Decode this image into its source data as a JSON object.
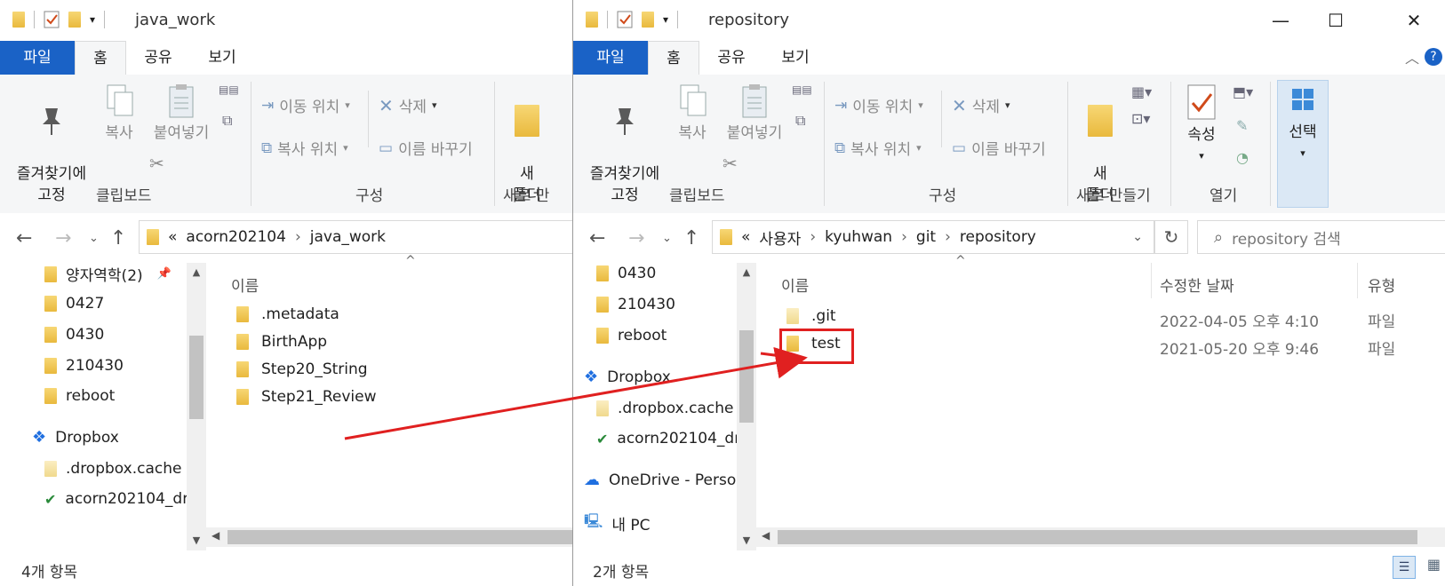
{
  "left_window": {
    "title": "java_work",
    "menu": {
      "file": "파일",
      "home": "홈",
      "share": "공유",
      "view": "보기"
    },
    "ribbon": {
      "pin": "즐겨찾기에\n고정",
      "copy": "복사",
      "paste": "붙여넣기",
      "move_to": "이동 위치",
      "copy_to": "복사 위치",
      "delete": "삭제",
      "rename": "이름 바꾸기",
      "new_folder": "새\n폴더",
      "groups": {
        "clipboard": "클립보드",
        "organize": "구성",
        "new": "새로 만"
      }
    },
    "address": {
      "overflow": "«",
      "crumbs": [
        "acorn202104",
        "java_work"
      ]
    },
    "nav": [
      {
        "label": "양자역학(2)",
        "pinned": true
      },
      {
        "label": "0427"
      },
      {
        "label": "0430"
      },
      {
        "label": "210430"
      },
      {
        "label": "reboot"
      },
      {
        "label": "Dropbox"
      },
      {
        "label": ".dropbox.cache"
      },
      {
        "label": "acorn202104_dr"
      }
    ],
    "columns": {
      "name": "이름"
    },
    "files": [
      ".metadata",
      "BirthApp",
      "Step20_String",
      "Step21_Review"
    ],
    "status": "4개 항목"
  },
  "right_window": {
    "title": "repository",
    "menu": {
      "file": "파일",
      "home": "홈",
      "share": "공유",
      "view": "보기"
    },
    "ribbon": {
      "pin": "즐겨찾기에\n고정",
      "copy": "복사",
      "paste": "붙여넣기",
      "move_to": "이동 위치",
      "copy_to": "복사 위치",
      "delete": "삭제",
      "rename": "이름 바꾸기",
      "new_folder": "새\n폴더",
      "properties": "속성",
      "select": "선택",
      "groups": {
        "clipboard": "클립보드",
        "organize": "구성",
        "new": "새로 만들기",
        "open": "열기"
      }
    },
    "address": {
      "overflow": "«",
      "crumbs": [
        "사용자",
        "kyuhwan",
        "git",
        "repository"
      ]
    },
    "search_placeholder": "repository 검색",
    "nav": [
      {
        "label": "0430"
      },
      {
        "label": "210430"
      },
      {
        "label": "reboot"
      },
      {
        "label": "Dropbox"
      },
      {
        "label": ".dropbox.cache"
      },
      {
        "label": "acorn202104_dr"
      },
      {
        "label": "OneDrive - Persor"
      },
      {
        "label": "내 PC"
      }
    ],
    "columns": {
      "name": "이름",
      "modified": "수정한 날짜",
      "type": "유형"
    },
    "files": [
      {
        "name": ".git",
        "modified": "2022-04-05 오후 4:10",
        "type": "파일"
      },
      {
        "name": "test",
        "modified": "2021-05-20 오후 9:46",
        "type": "파일",
        "highlighted": true
      }
    ],
    "status": "2개 항목"
  },
  "annotation": {
    "color": "#e02020"
  }
}
